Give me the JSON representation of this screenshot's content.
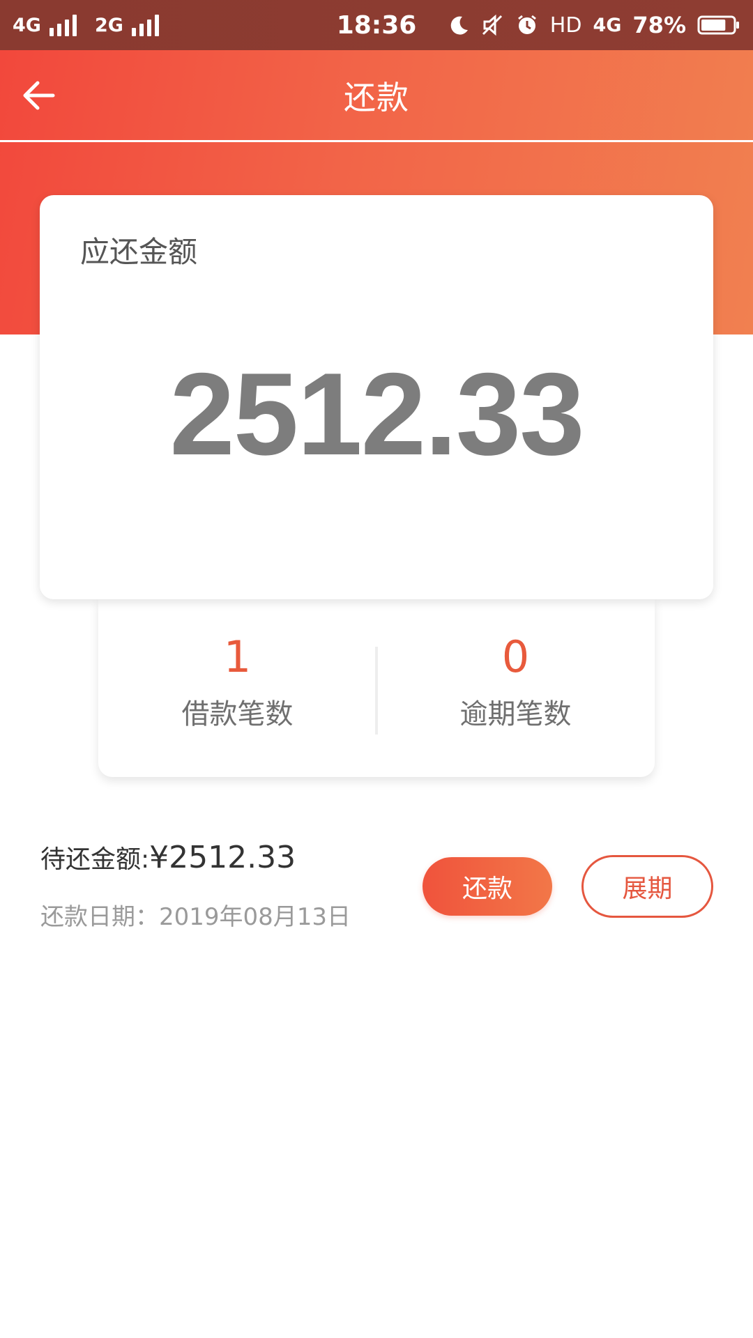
{
  "status_bar": {
    "network_1": "4G",
    "network_2": "2G",
    "time": "18:36",
    "hd": "HD",
    "data_network": "4G",
    "battery_percent": "78%",
    "battery_level": 0.78,
    "icons": [
      "moon-icon",
      "mute-icon",
      "alarm-icon",
      "battery-icon"
    ]
  },
  "header": {
    "title": "还款",
    "back_icon": "arrow-left-icon"
  },
  "amount_card": {
    "label": "应还金额",
    "value": "2512.33"
  },
  "stats": {
    "loans": {
      "value": "1",
      "label": "借款笔数"
    },
    "overdue": {
      "value": "0",
      "label": "逾期笔数"
    }
  },
  "repayment": {
    "due_label": "待还金额:",
    "due_amount": "¥2512.33",
    "date_label": "还款日期：",
    "date_value": "2019年08月13日",
    "repay_button": "还款",
    "extend_button": "展期"
  },
  "colors": {
    "brand_red": "#f2483c",
    "brand_orange": "#f18050",
    "accent_text": "#e85a3c"
  }
}
